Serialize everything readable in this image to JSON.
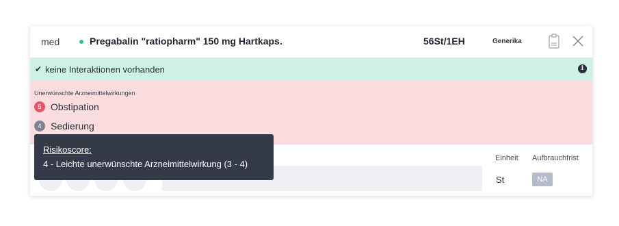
{
  "header": {
    "type": "med",
    "medication_name": "Pregabalin \"ratiopharm\" 150 mg Hartkaps.",
    "package": "56St/1EH",
    "generic_label": "Generika",
    "status_dot_color": "#2fc08a",
    "icons": [
      "clipboard-icon",
      "close-icon"
    ]
  },
  "interactions": {
    "text": "keine Interaktionen vorhanden",
    "check_icon": "✔",
    "info_icon": "i",
    "background": "#cdf2e4"
  },
  "side_effects": {
    "title": "Unerwünschte Arzneimittelwirkungen",
    "background": "#fbdde0",
    "items": [
      {
        "score": "5",
        "label": "Obstipation",
        "color": "#e5586a"
      },
      {
        "score": "4",
        "label": "Sedierung",
        "color": "#7c8290"
      }
    ]
  },
  "dosage": {
    "einheit_label": "Einheit",
    "einheit_value": "St",
    "aufbrauchfrist_label": "Aufbrauchfrist",
    "aufbrauchfrist_value": "NA"
  },
  "tooltip": {
    "title": "Risikoscore:",
    "text": "4 - Leichte unerwünschte Arzneimittelwirkung (3 - 4)"
  }
}
